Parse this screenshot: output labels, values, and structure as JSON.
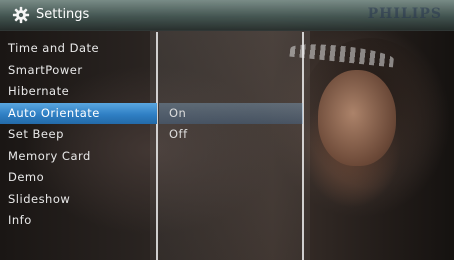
{
  "header": {
    "title": "Settings",
    "brand": "PHILIPS",
    "icon": "gear-icon"
  },
  "menu": {
    "selected_index": 3,
    "items": [
      {
        "label": "Time and Date"
      },
      {
        "label": "SmartPower"
      },
      {
        "label": "Hibernate"
      },
      {
        "label": "Auto Orientate"
      },
      {
        "label": "Set Beep"
      },
      {
        "label": "Memory Card"
      },
      {
        "label": "Demo"
      },
      {
        "label": "Slideshow"
      },
      {
        "label": "Info"
      }
    ]
  },
  "options": {
    "items": [
      {
        "label": "On"
      },
      {
        "label": "Off"
      }
    ]
  },
  "colors": {
    "selection": "#2f7fc4",
    "text": "#e9e9e9"
  }
}
